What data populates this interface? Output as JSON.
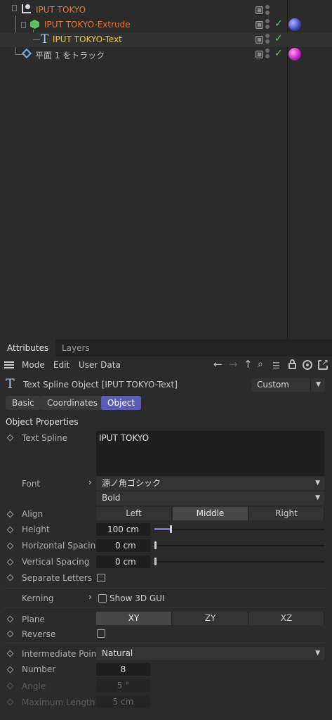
{
  "objects": [
    {
      "name": "IPUT TOKYO",
      "color": "#e07a3a"
    },
    {
      "name": "IPUT TOKYO-Extrude",
      "color": "#e07a3a"
    },
    {
      "name": "IPUT TOKYO-Text",
      "color": "#f0c93a"
    },
    {
      "name": "平面 1 をトラック",
      "color": "#c8c8c8"
    }
  ],
  "attributes": {
    "tabs": [
      "Attributes",
      "Layers"
    ],
    "menu": [
      "Mode",
      "Edit",
      "User Data"
    ],
    "object_title": "Text Spline Object [IPUT TOKYO-Text]",
    "preset": "Custom",
    "subtabs": [
      "Basic",
      "Coordinates",
      "Object"
    ],
    "section": "Object Properties",
    "text_spline_label": "Text Spline",
    "text_spline_value": "IPUT TOKYO",
    "font_label": "Font",
    "font_family": "源ノ角ゴシック",
    "font_weight": "Bold",
    "align_label": "Align",
    "align_options": [
      "Left",
      "Middle",
      "Right"
    ],
    "align_selected": "Middle",
    "height_label": "Height",
    "height_value": "100 cm",
    "height_slider": 0.1,
    "hspacing_label": "Horizontal Spacing",
    "hspacing_value": "0 cm",
    "vspacing_label": "Vertical Spacing",
    "vspacing_value": "0 cm",
    "separate_label": "Separate Letters",
    "kerning_label": "Kerning",
    "show3d_label": "Show 3D GUI",
    "plane_label": "Plane",
    "plane_options": [
      "XY",
      "ZY",
      "XZ"
    ],
    "plane_selected": "XY",
    "reverse_label": "Reverse",
    "intpoints_label": "Intermediate Points",
    "intpoints_value": "Natural",
    "number_label": "Number",
    "number_value": "8",
    "angle_label": "Angle",
    "angle_value": "5 °",
    "maxlen_label": "Maximum Length",
    "maxlen_value": "5 cm"
  }
}
